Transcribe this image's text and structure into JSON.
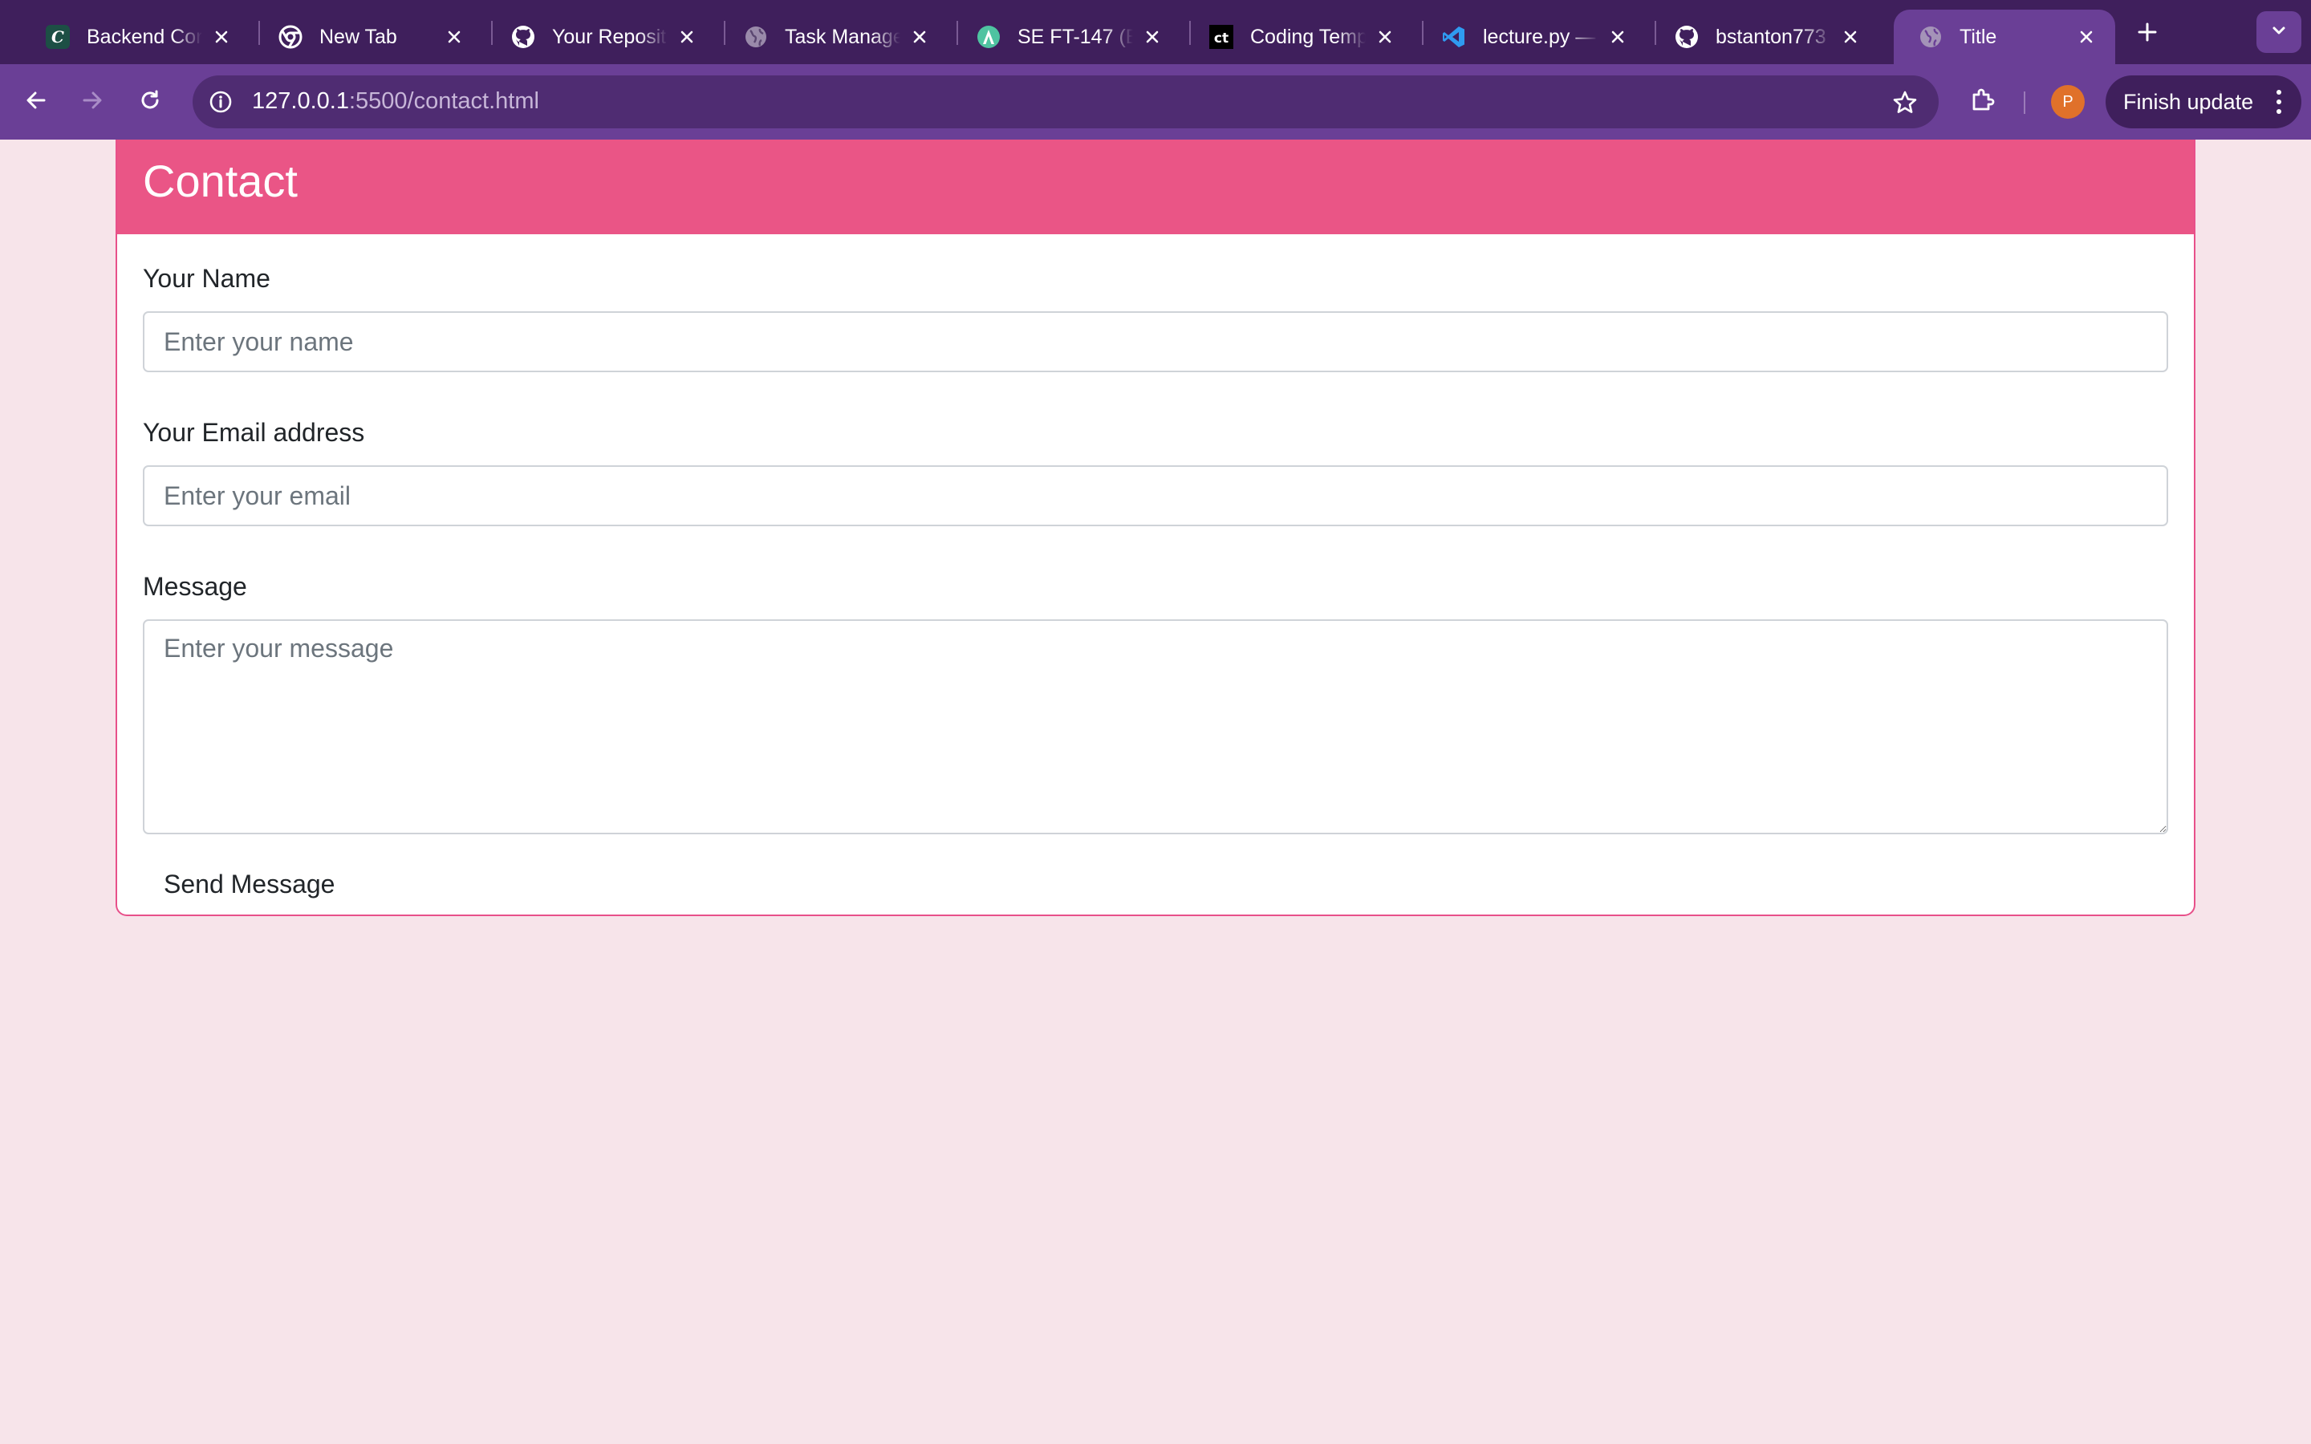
{
  "browser": {
    "tabs": [
      {
        "title": "Backend Cor",
        "icon": "coding-temple-c-icon"
      },
      {
        "title": "New Tab",
        "icon": "chrome-icon"
      },
      {
        "title": "Your Reposit",
        "icon": "github-icon"
      },
      {
        "title": "Task Manage",
        "icon": "globe-icon"
      },
      {
        "title": "SE FT-147 (B",
        "icon": "app-icon"
      },
      {
        "title": "Coding Temp",
        "icon": "ct-icon"
      },
      {
        "title": "lecture.py —",
        "icon": "vscode-icon"
      },
      {
        "title": "bstanton773",
        "icon": "github-icon"
      },
      {
        "title": "Title",
        "icon": "globe-icon",
        "active": true
      }
    ],
    "address": {
      "host": "127.0.0.1",
      "path": ":5500/contact.html"
    },
    "profile_initial": "P",
    "update_label": "Finish update",
    "colors": {
      "tabbar": "#3f1f5c",
      "toolbar": "#6a3f96",
      "omnibox": "#4f2c72"
    }
  },
  "page": {
    "header_title": "Contact",
    "colors": {
      "background": "#f7e4ea",
      "header": "#ea5586",
      "border": "#e8508a"
    },
    "form": {
      "name_label": "Your Name",
      "name_placeholder": "Enter your name",
      "email_label": "Your Email address",
      "email_placeholder": "Enter your email",
      "message_label": "Message",
      "message_placeholder": "Enter your message",
      "submit_label": "Send Message"
    }
  }
}
